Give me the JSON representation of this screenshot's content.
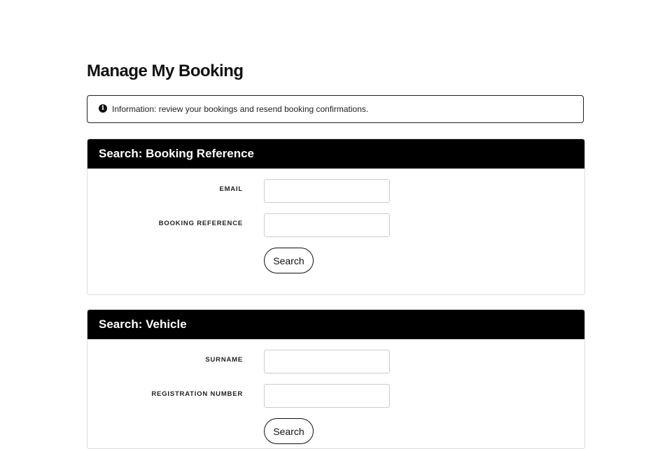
{
  "page": {
    "title": "Manage My Booking"
  },
  "info": {
    "icon": "info-circle-icon",
    "text": "Information: review your bookings and resend booking confirmations."
  },
  "booking_search": {
    "heading": "Search: Booking Reference",
    "email_label": "EMAIL",
    "email_value": "",
    "reference_label": "BOOKING REFERENCE",
    "reference_value": "",
    "button_label": "Search"
  },
  "vehicle_search": {
    "heading": "Search: Vehicle",
    "surname_label": "SURNAME",
    "surname_value": "",
    "registration_label": "REGISTRATION NUMBER",
    "registration_value": "",
    "button_label": "Search"
  }
}
